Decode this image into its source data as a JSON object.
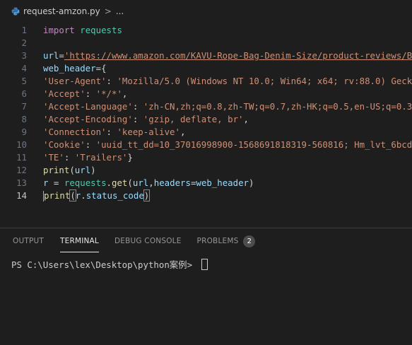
{
  "breadcrumb": {
    "file_name": "request-amzon.py",
    "separator": ">",
    "ellipsis": "..."
  },
  "editor": {
    "current_line": 14,
    "lines": [
      {
        "num": "1",
        "tokens": [
          [
            "kw",
            "import"
          ],
          [
            "punc",
            " "
          ],
          [
            "mod",
            "requests"
          ]
        ]
      },
      {
        "num": "2",
        "tokens": []
      },
      {
        "num": "3",
        "tokens": [
          [
            "var",
            "url"
          ],
          [
            "punc",
            "="
          ],
          [
            "url",
            "'https://www.amazon.com/KAVU-Rope-Bag-Denim-Size/product-reviews/B"
          ]
        ]
      },
      {
        "num": "4",
        "tokens": [
          [
            "var",
            "web_header"
          ],
          [
            "punc",
            "={"
          ]
        ]
      },
      {
        "num": "5",
        "tokens": [
          [
            "str",
            "'User-Agent'"
          ],
          [
            "punc",
            ": "
          ],
          [
            "str",
            "'Mozilla/5.0 (Windows NT 10.0; Win64; x64; rv:88.0) Geck"
          ]
        ]
      },
      {
        "num": "6",
        "tokens": [
          [
            "str",
            "'Accept'"
          ],
          [
            "punc",
            ": "
          ],
          [
            "str",
            "'*/*'"
          ],
          [
            "punc",
            ","
          ]
        ]
      },
      {
        "num": "7",
        "tokens": [
          [
            "str",
            "'Accept-Language'"
          ],
          [
            "punc",
            ": "
          ],
          [
            "str",
            "'zh-CN,zh;q=0.8,zh-TW;q=0.7,zh-HK;q=0.5,en-US;q=0.3"
          ]
        ]
      },
      {
        "num": "8",
        "tokens": [
          [
            "str",
            "'Accept-Encoding'"
          ],
          [
            "punc",
            ": "
          ],
          [
            "str",
            "'gzip, deflate, br'"
          ],
          [
            "punc",
            ","
          ]
        ]
      },
      {
        "num": "9",
        "tokens": [
          [
            "str",
            "'Connection'"
          ],
          [
            "punc",
            ": "
          ],
          [
            "str",
            "'keep-alive'"
          ],
          [
            "punc",
            ","
          ]
        ]
      },
      {
        "num": "10",
        "tokens": [
          [
            "str",
            "'Cookie'"
          ],
          [
            "punc",
            ": "
          ],
          [
            "str",
            "'uuid_tt_dd=10_37016998900-1568691818319-560816; Hm_lvt_6bcd"
          ]
        ]
      },
      {
        "num": "11",
        "tokens": [
          [
            "str",
            "'TE'"
          ],
          [
            "punc",
            ": "
          ],
          [
            "str",
            "'Trailers'"
          ],
          [
            "punc",
            "}"
          ]
        ]
      },
      {
        "num": "12",
        "tokens": [
          [
            "fn",
            "print"
          ],
          [
            "punc",
            "("
          ],
          [
            "var",
            "url"
          ],
          [
            "punc",
            ")"
          ]
        ]
      },
      {
        "num": "13",
        "tokens": [
          [
            "var",
            "r"
          ],
          [
            "punc",
            " = "
          ],
          [
            "mod",
            "requests"
          ],
          [
            "punc",
            "."
          ],
          [
            "fn",
            "get"
          ],
          [
            "punc",
            "("
          ],
          [
            "var",
            "url"
          ],
          [
            "punc",
            ","
          ],
          [
            "var",
            "headers"
          ],
          [
            "punc",
            "="
          ],
          [
            "var",
            "web_header"
          ],
          [
            "punc",
            ")"
          ]
        ]
      },
      {
        "num": "14",
        "tokens": [
          [
            "fn",
            "print"
          ],
          [
            "hl",
            "("
          ],
          [
            "var",
            "r"
          ],
          [
            "punc",
            "."
          ],
          [
            "var",
            "status_code"
          ],
          [
            "hl",
            ")"
          ]
        ]
      }
    ]
  },
  "panel": {
    "tabs": [
      {
        "label": "OUTPUT",
        "active": false,
        "name": "tab-output"
      },
      {
        "label": "TERMINAL",
        "active": true,
        "name": "tab-terminal"
      },
      {
        "label": "DEBUG CONSOLE",
        "active": false,
        "name": "tab-debug-console"
      },
      {
        "label": "PROBLEMS",
        "active": false,
        "name": "tab-problems"
      }
    ],
    "problems_count": "2",
    "terminal_prompt": "PS C:\\Users\\lex\\Desktop\\python案例> "
  },
  "colors": {
    "background": "#1e1e1e",
    "keyword": "#c586c0",
    "module": "#4ec9b0",
    "variable": "#9cdcfe",
    "string": "#ce9178",
    "function": "#dcdcaa"
  }
}
